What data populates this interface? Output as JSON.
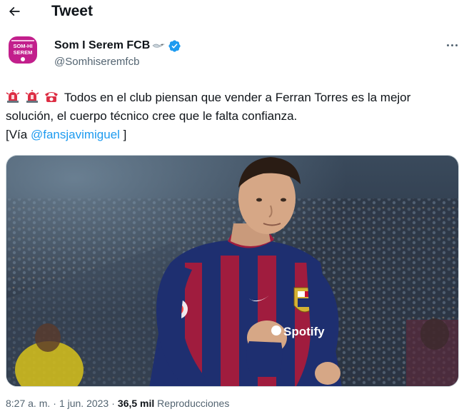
{
  "header": {
    "title": "Tweet",
    "back_icon": "arrow-left-icon"
  },
  "author": {
    "display_name": "Som I Serem FCB",
    "handle": "@Somhiseremfcb",
    "verified": true,
    "verified_color": "#1d9bf0",
    "avatar_lines": [
      "SOM-HI",
      "SEREM"
    ],
    "avatar_color": "#c21f8c",
    "name_emoji": "seagull-icon"
  },
  "tweet": {
    "line1_text": "Todos en el club piensan que vender a Ferran Torres es la mejor",
    "line2_text": "solución, el cuerpo técnico cree que le falta confianza.",
    "line3_prefix": "[Vía ",
    "mention": "@fansjavimiguel",
    "line3_suffix": " ]",
    "emojis": [
      "rotating-light-icon",
      "rotating-light-icon",
      "telephone-icon"
    ],
    "mention_color": "#1d9bf0"
  },
  "media": {
    "alt": "Ferran Torres con la camiseta del FC Barcelona",
    "shirt_sponsor": "Spotify"
  },
  "meta": {
    "time": "8:27 a. m.",
    "separator": "·",
    "date": "1 jun. 2023",
    "views_count": "36,5 mil",
    "views_label": "Reproducciones"
  }
}
